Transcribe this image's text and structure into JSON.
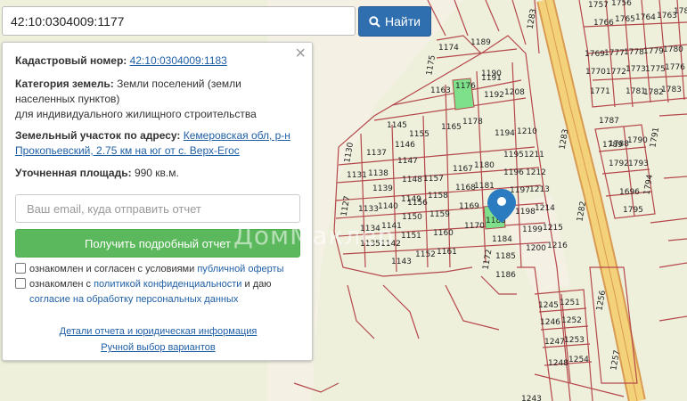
{
  "search": {
    "value": "42:10:0304009:1177",
    "button_label": "Найти"
  },
  "info": {
    "cadastral_label": "Кадастровый номер:",
    "cadastral_value": "42:10:0304009:1183",
    "category_label": "Категория земель:",
    "category_value_1": "Земли поселений (земли",
    "category_value_2": "населенных пунктов)",
    "category_value_3": "для индивидуального жилищного строительства",
    "address_label": "Земельный участок по адресу:",
    "address_value_1": "Кемеровская обл, р-н",
    "address_value_2": "Прокопьевский, 2.75 км на юг от с. Верх-Егос",
    "area_label": "Уточненная площадь:",
    "area_value": "990 кв.м."
  },
  "form": {
    "email_placeholder": "Ваш email, куда отправить отчет",
    "submit_label": "Получить подробный отчет",
    "consent1_text": "ознакомлен и согласен с условиями ",
    "consent1_link": "публичной оферты",
    "consent2_text": "ознакомлен с ",
    "consent2_link1": "политикой конфиденциальности",
    "consent2_mid": " и даю",
    "consent2_link2": "согласие на обработку персональных данных"
  },
  "links": {
    "details": "Детали отчета и юридическая информация",
    "manual": "Ручной выбор вариантов"
  },
  "watermark": "ДомМаклер",
  "map": {
    "parcel_labels": [
      "1176",
      "1174",
      "1189",
      "1175",
      "1190",
      "1163",
      "1191",
      "1192",
      "1208",
      "1145",
      "1155",
      "1178",
      "1165",
      "1194",
      "1210",
      "1146",
      "1180",
      "1195",
      "1211",
      "1130",
      "1137",
      "1147",
      "1167",
      "1196",
      "1212",
      "1131",
      "1138",
      "1148",
      "1157",
      "1158",
      "1168",
      "1181",
      "1197",
      "1213",
      "1139",
      "1149",
      "1156",
      "1169",
      "1198",
      "1214",
      "1127",
      "1133",
      "1140",
      "1150",
      "1159",
      "1183",
      "1184",
      "1199",
      "1215",
      "1134",
      "1141",
      "1151",
      "1160",
      "1170",
      "1172",
      "1185",
      "1200",
      "1216",
      "1135",
      "1142",
      "1152",
      "1161",
      "1186",
      "1143",
      "1245",
      "1251",
      "1246",
      "1252",
      "1247",
      "1253",
      "1248",
      "1254",
      "1243",
      "1256",
      "1257",
      "1177",
      "1283",
      "1282",
      "1176x",
      "1189x",
      "1787",
      "1788",
      "1789",
      "1790",
      "1791",
      "1792",
      "1793",
      "1794",
      "1795",
      "1696",
      "1783",
      "1782",
      "1769",
      "1770",
      "1771",
      "1772",
      "1773",
      "1777",
      "1778",
      "1779",
      "1780",
      "1781",
      "1757",
      "1756",
      "1766",
      "1765",
      "1764",
      "1763",
      "1762",
      "1761",
      "1767",
      "1768",
      "1776",
      "1775",
      "1774",
      "1785",
      "1786",
      "1760",
      "1759",
      "1758"
    ],
    "colors": {
      "parcel_line": "#b5474b",
      "highlight": "#7ee08a",
      "road": "#f3d27a",
      "marker": "#2b7bc0"
    }
  }
}
